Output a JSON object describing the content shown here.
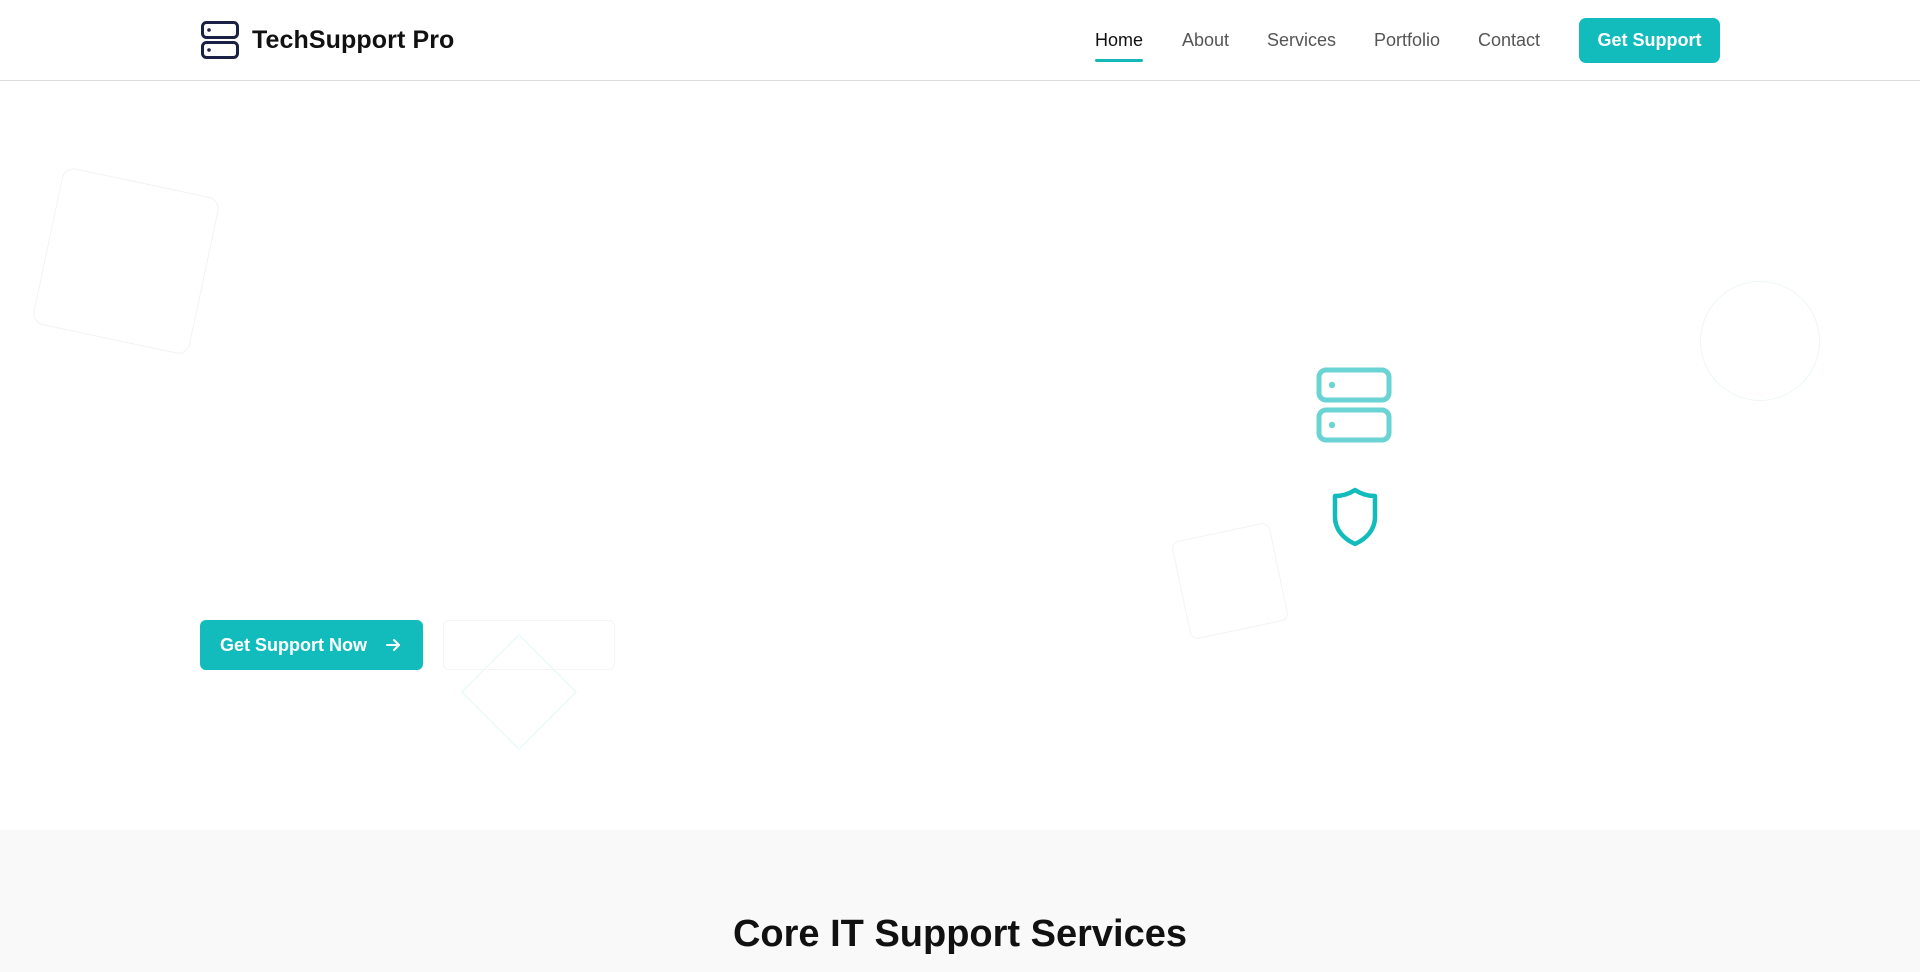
{
  "brand": {
    "name": "TechSupport Pro",
    "logo_icon": "server-icon",
    "logo_color": "#1a1f44"
  },
  "nav": {
    "items": [
      {
        "label": "Home",
        "active": true
      },
      {
        "label": "About",
        "active": false
      },
      {
        "label": "Services",
        "active": false
      },
      {
        "label": "Portfolio",
        "active": false
      },
      {
        "label": "Contact",
        "active": false
      }
    ],
    "cta_label": "Get Support"
  },
  "hero": {
    "primary_button_label": "Get Support Now",
    "primary_button_icon": "arrow-right-icon",
    "illustration_icons": [
      "server-icon",
      "shield-icon"
    ]
  },
  "services": {
    "title": "Core IT Support Services"
  },
  "colors": {
    "accent": "#13bcbc",
    "accent_light": "#6ad3d3",
    "text_primary": "#111111",
    "text_muted": "#555555",
    "section_bg": "#f9f9f9"
  }
}
